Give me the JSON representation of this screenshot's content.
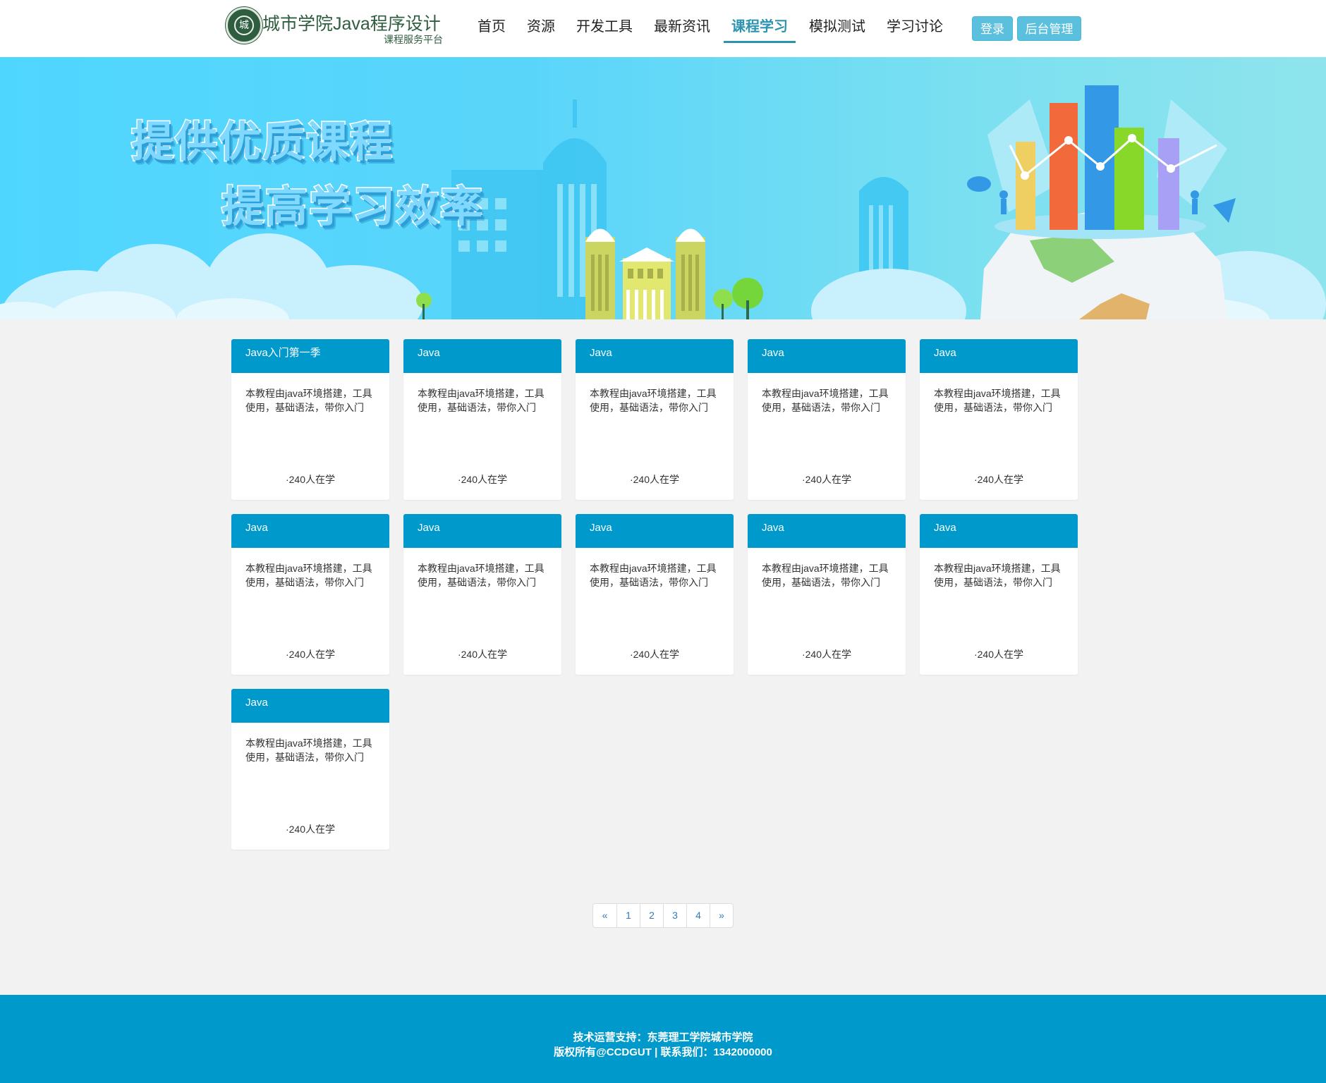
{
  "site": {
    "title": "城市学院Java程序设计",
    "subtitle": "课程服务平台",
    "seal_glyph": "城"
  },
  "nav": {
    "items": [
      {
        "label": "首页",
        "active": false
      },
      {
        "label": "资源",
        "active": false
      },
      {
        "label": "开发工具",
        "active": false
      },
      {
        "label": "最新资讯",
        "active": false
      },
      {
        "label": "课程学习",
        "active": true
      },
      {
        "label": "模拟测试",
        "active": false
      },
      {
        "label": "学习讨论",
        "active": false
      }
    ]
  },
  "auth": {
    "login_label": "登录",
    "admin_label": "后台管理"
  },
  "banner": {
    "slogan_line1": "提供优质课程",
    "slogan_line2": "提高学习效率"
  },
  "courses": [
    {
      "title": "Java入门第一季",
      "description": "本教程由java环境搭建，工具使用，基础语法，带你入门",
      "students": "·240人在学"
    },
    {
      "title": "Java",
      "description": "本教程由java环境搭建，工具使用，基础语法，带你入门",
      "students": "·240人在学"
    },
    {
      "title": "Java",
      "description": "本教程由java环境搭建，工具使用，基础语法，带你入门",
      "students": "·240人在学"
    },
    {
      "title": "Java",
      "description": "本教程由java环境搭建，工具使用，基础语法，带你入门",
      "students": "·240人在学"
    },
    {
      "title": "Java",
      "description": "本教程由java环境搭建，工具使用，基础语法，带你入门",
      "students": "·240人在学"
    },
    {
      "title": "Java",
      "description": "本教程由java环境搭建，工具使用，基础语法，带你入门",
      "students": "·240人在学"
    },
    {
      "title": "Java",
      "description": "本教程由java环境搭建，工具使用，基础语法，带你入门",
      "students": "·240人在学"
    },
    {
      "title": "Java",
      "description": "本教程由java环境搭建，工具使用，基础语法，带你入门",
      "students": "·240人在学"
    },
    {
      "title": "Java",
      "description": "本教程由java环境搭建，工具使用，基础语法，带你入门",
      "students": "·240人在学"
    },
    {
      "title": "Java",
      "description": "本教程由java环境搭建，工具使用，基础语法，带你入门",
      "students": "·240人在学"
    },
    {
      "title": "Java",
      "description": "本教程由java环境搭建，工具使用，基础语法，带你入门",
      "students": "·240人在学"
    }
  ],
  "pagination": {
    "prev": "«",
    "pages": [
      "1",
      "2",
      "3",
      "4"
    ],
    "next": "»"
  },
  "footer": {
    "line1": "技术运营支持：东莞理工学院城市学院",
    "line2": "版权所有@CCDGUT | 联系我们：1342000000"
  },
  "colors": {
    "accent": "#0099cc",
    "nav_active": "#2c93b0",
    "button": "#5bc0de",
    "brand_green": "#2f5d3f"
  }
}
